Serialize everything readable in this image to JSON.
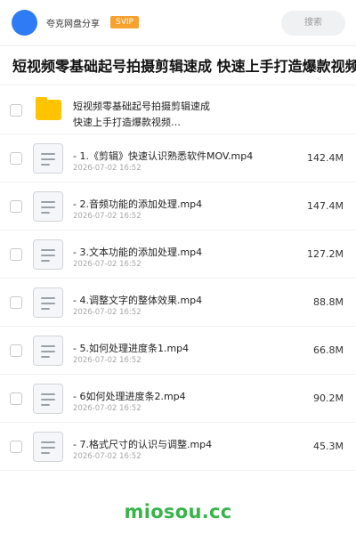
{
  "header": {
    "user_name": "夸克网盘分享",
    "badge": "SVIP",
    "search_label": "搜索"
  },
  "title": "短视频零基础起号拍摄剪辑速成 快速上手打造爆款视频之路",
  "folder": {
    "name_line1": "短视频零基础起号拍摄剪辑速成",
    "name_line2": "快速上手打造爆款视频…"
  },
  "files": [
    {
      "name": "- 1.《剪辑》快速认识熟悉软件MOV.mp4",
      "date": "2026-07-02 16:52",
      "size": "142.4M"
    },
    {
      "name": "- 2.音频功能的添加处理.mp4",
      "date": "2026-07-02 16:52",
      "size": "147.4M"
    },
    {
      "name": "- 3.文本功能的添加处理.mp4",
      "date": "2026-07-02 16:52",
      "size": "127.2M"
    },
    {
      "name": "- 4.调整文字的整体效果.mp4",
      "date": "2026-07-02 16:52",
      "size": "88.8M"
    },
    {
      "name": "- 5.如何处理进度条1.mp4",
      "date": "2026-07-02 16:52",
      "size": "66.8M"
    },
    {
      "name": "- 6如何处理进度条2.mp4",
      "date": "2026-07-02 16:52",
      "size": "90.2M"
    },
    {
      "name": "- 7.格式尺寸的认识与调整.mp4",
      "date": "2026-07-02 16:52",
      "size": "45.3M"
    }
  ],
  "watermark": "miosou.cc",
  "colors": {
    "avatar": "#2f7bf5",
    "svip_badge": "#f7a12f",
    "folder": "#ffc300",
    "watermark": "#38b54a"
  },
  "icons": {
    "folder": "folder-icon",
    "file": "video-file-icon"
  }
}
